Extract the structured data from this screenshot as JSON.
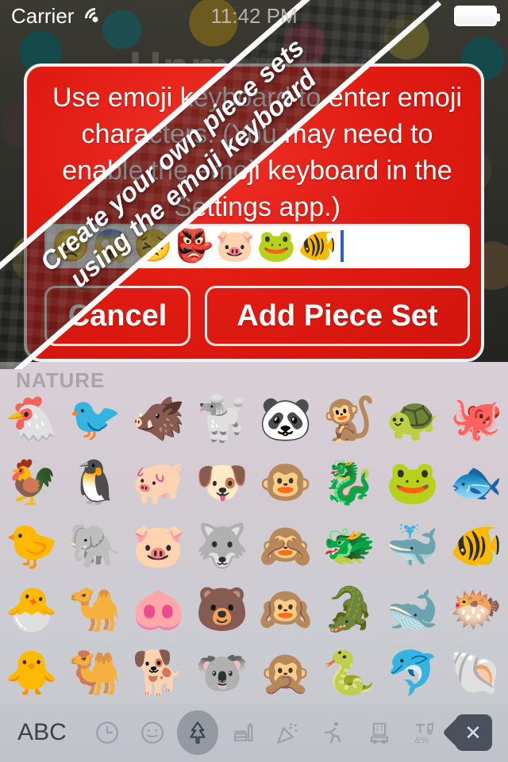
{
  "status_bar": {
    "carrier": "Carrier",
    "time": "11:42 PM",
    "wifi_icon": "wifi-icon",
    "battery_icon": "battery-icon"
  },
  "background": {
    "faded_title": "Unmatched"
  },
  "ribbon": {
    "line1": "Create your own piece sets",
    "line2": "using the emoji keyboard"
  },
  "dialog": {
    "message": "Use emoji keyboard to enter emoji characters. (You may need to enable the emoji keyboard in the Settings app.)",
    "accent_color": "#e01b12",
    "input": {
      "value": [
        "😠",
        "😱",
        "😣",
        "👺",
        "🐷",
        "🐸",
        "🐠"
      ],
      "placeholder": ""
    },
    "cancel_label": "Cancel",
    "add_label": "Add Piece Set"
  },
  "keyboard": {
    "section_title": "NATURE",
    "rows": [
      [
        "🐔",
        "🐦",
        "🐗",
        "🐩",
        "🐼",
        "🐒",
        "🐢",
        "🐙"
      ],
      [
        "🐓",
        "🐧",
        "🐖",
        "🐶",
        "🐵",
        "🐉",
        "🐸",
        "🐟"
      ],
      [
        "🐤",
        "🐘",
        "🐷",
        "🐺",
        "🙈",
        "🐲",
        "🐳",
        "🐠"
      ],
      [
        "🐣",
        "🐪",
        "🐽",
        "🐻",
        "🙉",
        "🐊",
        "🐋",
        "🐡"
      ],
      [
        "🐥",
        "🐫",
        "🐕",
        "🐨",
        "🙊",
        "🐍",
        "🐬",
        "🐚"
      ]
    ],
    "toolbar": {
      "abc_label": "ABC",
      "categories": [
        {
          "name": "recent",
          "icon": "clock-icon",
          "selected": false
        },
        {
          "name": "smileys",
          "icon": "smiley-icon",
          "selected": false
        },
        {
          "name": "nature",
          "icon": "tree-icon",
          "selected": true
        },
        {
          "name": "food",
          "icon": "food-icon",
          "selected": false
        },
        {
          "name": "celebration",
          "icon": "party-popper-icon",
          "selected": false
        },
        {
          "name": "activity",
          "icon": "runner-icon",
          "selected": false
        },
        {
          "name": "travel",
          "icon": "car-building-icon",
          "selected": false
        },
        {
          "name": "symbols",
          "icon": "symbols-icon",
          "selected": false
        }
      ],
      "symbols_label": "&%",
      "delete_icon": "delete-backspace-icon"
    }
  }
}
